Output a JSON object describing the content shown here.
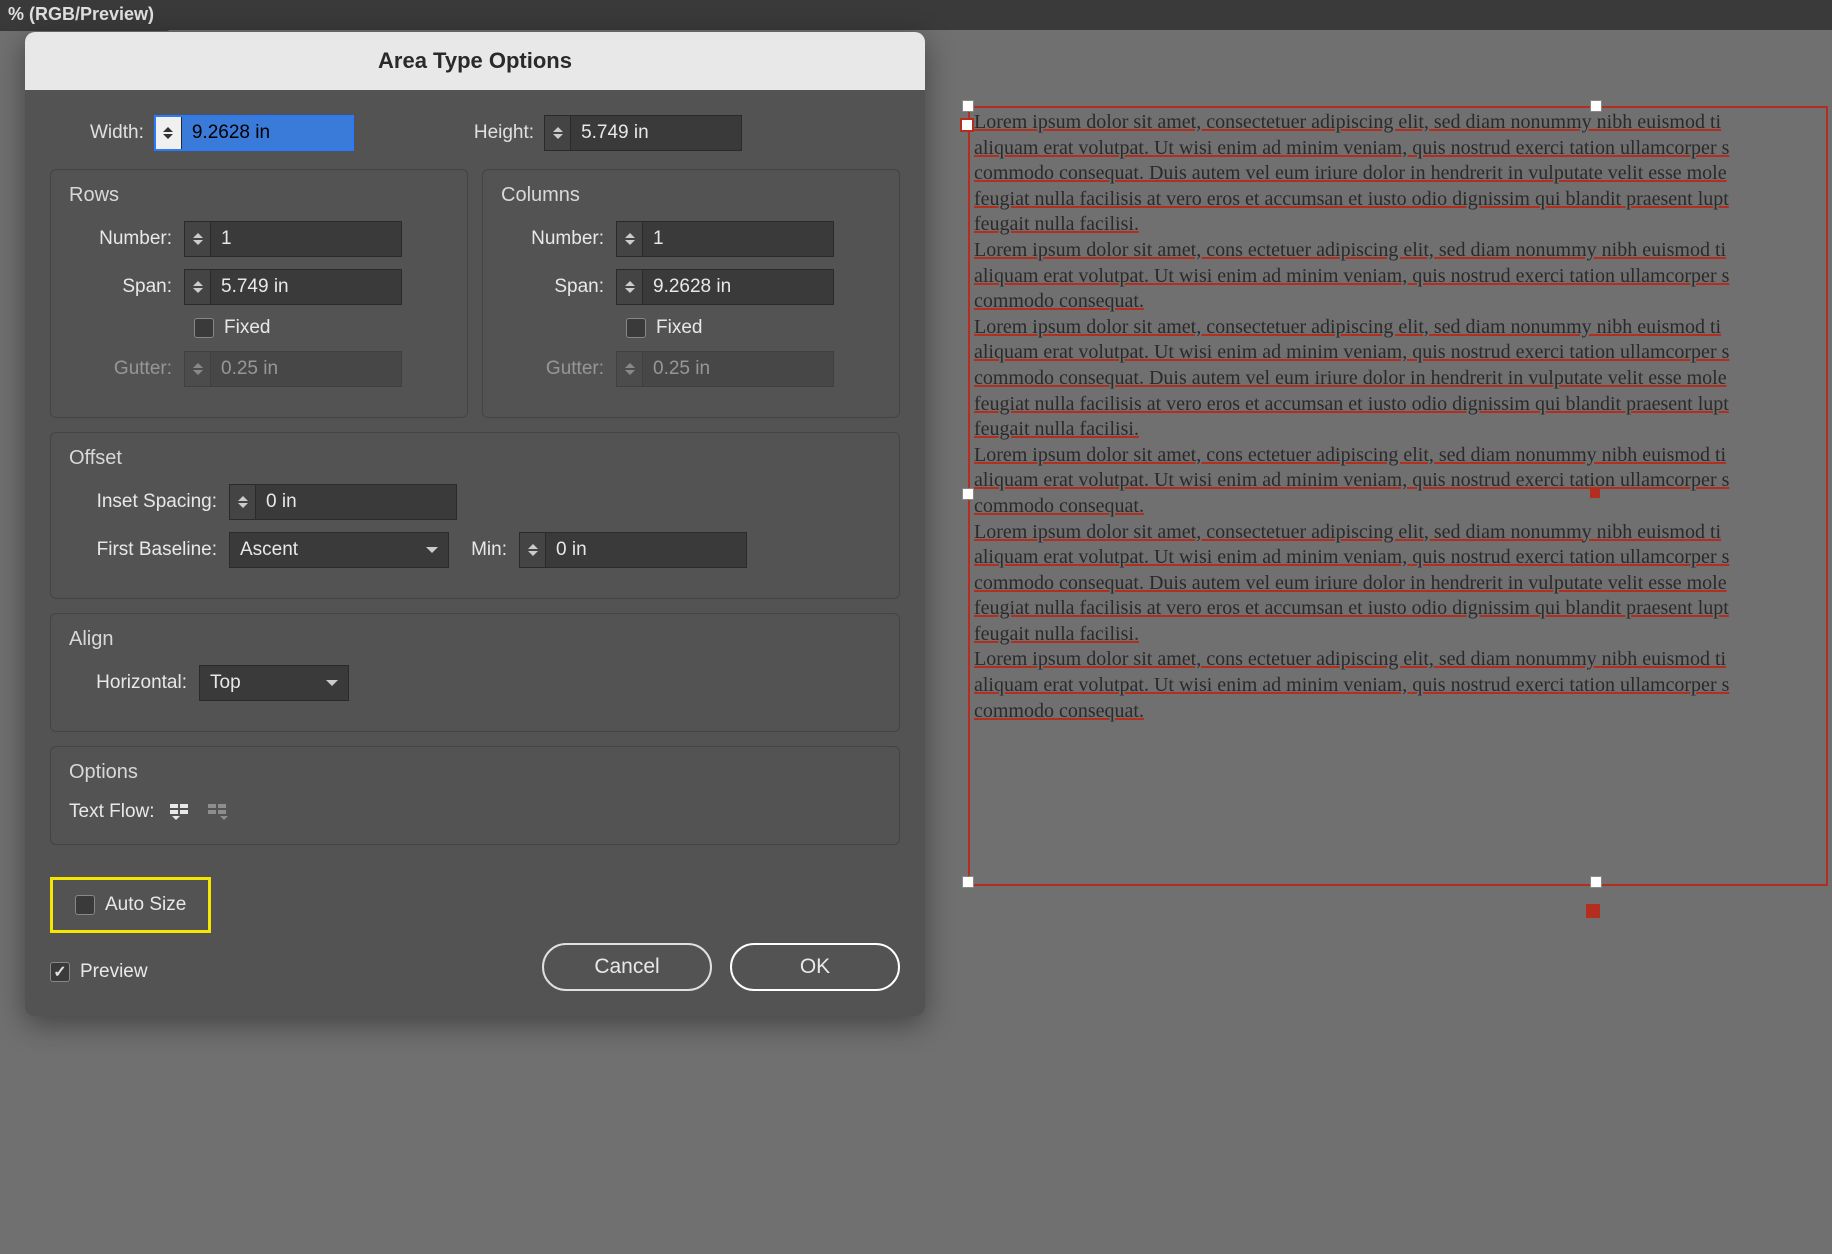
{
  "top_tab": "% (RGB/Preview)",
  "dialog": {
    "title": "Area Type Options",
    "width_label": "Width:",
    "width_value": "9.2628 in",
    "height_label": "Height:",
    "height_value": "5.749 in",
    "rows": {
      "title": "Rows",
      "number_label": "Number:",
      "number_value": "1",
      "span_label": "Span:",
      "span_value": "5.749 in",
      "fixed_label": "Fixed",
      "gutter_label": "Gutter:",
      "gutter_value": "0.25 in"
    },
    "columns": {
      "title": "Columns",
      "number_label": "Number:",
      "number_value": "1",
      "span_label": "Span:",
      "span_value": "9.2628 in",
      "fixed_label": "Fixed",
      "gutter_label": "Gutter:",
      "gutter_value": "0.25 in"
    },
    "offset": {
      "title": "Offset",
      "inset_label": "Inset Spacing:",
      "inset_value": "0 in",
      "baseline_label": "First Baseline:",
      "baseline_value": "Ascent",
      "min_label": "Min:",
      "min_value": "0 in"
    },
    "align": {
      "title": "Align",
      "horiz_label": "Horizontal:",
      "horiz_value": "Top"
    },
    "options": {
      "title": "Options",
      "textflow_label": "Text Flow:"
    },
    "autosize_label": "Auto Size",
    "preview_label": "Preview",
    "cancel": "Cancel",
    "ok": "OK"
  },
  "lorem": {
    "p1": "Lorem ipsum dolor sit amet, consectetuer adipiscing elit, sed diam nonummy nibh euismod ti",
    "p2": "aliquam erat volutpat. Ut wisi enim ad minim veniam, quis nostrud exerci tation ullamcorper s",
    "p3": "commodo consequat. Duis autem vel eum iriure dolor in hendrerit in vulputate velit esse mole",
    "p4": "feugiat nulla facilisis at vero eros et accumsan et iusto odio dignissim qui blandit praesent lupt",
    "p5": "feugait nulla facilisi.",
    "p6": "Lorem ipsum dolor sit amet, cons ectetuer adipiscing elit, sed diam nonummy nibh euismod ti",
    "p7": "aliquam erat volutpat. Ut wisi enim ad minim veniam, quis nostrud exerci tation ullamcorper s",
    "p8": "commodo consequat.",
    "p9": "Lorem ipsum dolor sit amet, consectetuer adipiscing elit, sed diam nonummy nibh euismod ti",
    "p10": "aliquam erat volutpat. Ut wisi enim ad minim veniam, quis nostrud exerci tation ullamcorper s",
    "p11": "commodo consequat. Duis autem vel eum iriure dolor in hendrerit in vulputate velit esse mole",
    "p12": "feugiat nulla facilisis at vero eros et accumsan et iusto odio dignissim qui blandit praesent lupt",
    "p13": "feugait nulla facilisi.",
    "p14": "Lorem ipsum dolor sit amet, cons ectetuer adipiscing elit, sed diam nonummy nibh euismod ti",
    "p15": "aliquam erat volutpat. Ut wisi enim ad minim veniam, quis nostrud exerci tation ullamcorper s",
    "p16": "commodo consequat.",
    "p17": "Lorem ipsum dolor sit amet, consectetuer adipiscing elit, sed diam nonummy nibh euismod ti",
    "p18": "aliquam erat volutpat. Ut wisi enim ad minim veniam, quis nostrud exerci tation ullamcorper s",
    "p19": "commodo consequat. Duis autem vel eum iriure dolor in hendrerit in vulputate velit esse mole",
    "p20": "feugiat nulla facilisis at vero eros et accumsan et iusto odio dignissim qui blandit praesent lupt",
    "p21": "feugait nulla facilisi.",
    "p22": "Lorem ipsum dolor sit amet, cons ectetuer adipiscing elit, sed diam nonummy nibh euismod ti",
    "p23": "aliquam erat volutpat. Ut wisi enim ad minim veniam, quis nostrud exerci tation ullamcorper s",
    "p24": "commodo consequat."
  }
}
